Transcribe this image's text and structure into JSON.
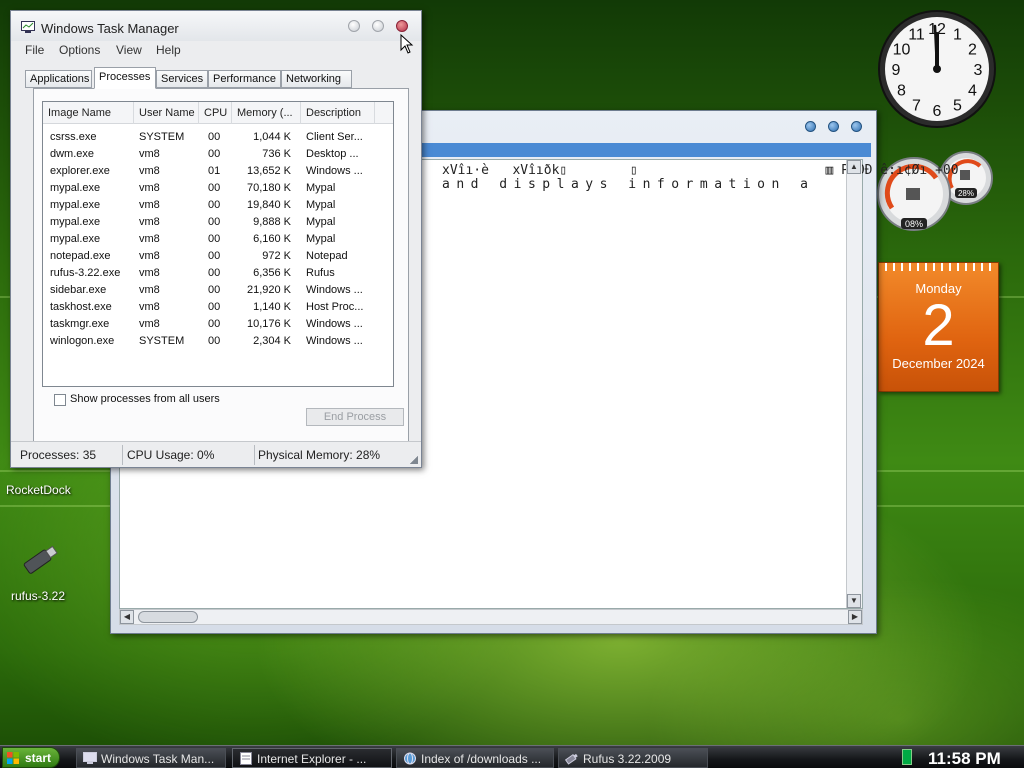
{
  "taskmanager": {
    "title": "Windows Task Manager",
    "menu": [
      "File",
      "Options",
      "View",
      "Help"
    ],
    "tabs": [
      "Applications",
      "Processes",
      "Services",
      "Performance",
      "Networking"
    ],
    "active_tab": "Processes",
    "columns": [
      "Image Name",
      "User Name",
      "CPU",
      "Memory (...",
      "Description"
    ],
    "processes": [
      [
        "csrss.exe",
        "SYSTEM",
        "00",
        "1,044 K",
        "Client Ser..."
      ],
      [
        "dwm.exe",
        "vm8",
        "00",
        "736 K",
        "Desktop ..."
      ],
      [
        "explorer.exe",
        "vm8",
        "01",
        "13,652 K",
        "Windows ..."
      ],
      [
        "mypal.exe",
        "vm8",
        "00",
        "70,180 K",
        "Mypal"
      ],
      [
        "mypal.exe",
        "vm8",
        "00",
        "19,840 K",
        "Mypal"
      ],
      [
        "mypal.exe",
        "vm8",
        "00",
        "9,888 K",
        "Mypal"
      ],
      [
        "mypal.exe",
        "vm8",
        "00",
        "6,160 K",
        "Mypal"
      ],
      [
        "notepad.exe",
        "vm8",
        "00",
        "972 K",
        "Notepad"
      ],
      [
        "rufus-3.22.exe",
        "vm8",
        "00",
        "6,356 K",
        "Rufus"
      ],
      [
        "sidebar.exe",
        "vm8",
        "00",
        "21,920 K",
        "Windows ..."
      ],
      [
        "taskhost.exe",
        "vm8",
        "00",
        "1,140 K",
        "Host Proc..."
      ],
      [
        "taskmgr.exe",
        "vm8",
        "00",
        "10,176 K",
        "Windows ..."
      ],
      [
        "winlogon.exe",
        "SYSTEM",
        "00",
        "2,304 K",
        "Windows ..."
      ]
    ],
    "show_all_label": "Show processes from all users",
    "end_process_label": "End Process",
    "status": {
      "processes": "Processes: 35",
      "cpu": "CPU Usage: 0%",
      "memory": "Physical Memory: 28%"
    }
  },
  "browser": {
    "line1": "xVîı·è   xVîıðk▯        ▯                        ▥ PàOÐ ê:ı¢Øı +00",
    "line2": "and displays information a"
  },
  "desktop": {
    "rocketdock_label": "RocketDock",
    "rufus_label": "rufus-3.22"
  },
  "gadgets": {
    "calendar": {
      "weekday": "Monday",
      "day": "2",
      "month_year": "December 2024"
    },
    "cpu_meter": {
      "cpu": "08%",
      "memory": "28%"
    },
    "clock": {
      "numbers": [
        "12",
        "1",
        "2",
        "3",
        "4",
        "5",
        "6",
        "7",
        "8",
        "9",
        "10",
        "11"
      ]
    }
  },
  "taskbar": {
    "start_label": "start",
    "buttons": [
      {
        "label": "Windows Task Man...",
        "icon": "taskmanager-icon"
      },
      {
        "label": "Internet Explorer - ...",
        "icon": "notepad-icon"
      },
      {
        "label": "Index of /downloads ...",
        "icon": "mypal-icon"
      },
      {
        "label": "Rufus 3.22.2009",
        "icon": "usb-icon"
      }
    ],
    "time": "11:58 PM"
  },
  "colors": {
    "accent": "#2f7a12",
    "calendar": "#e06410",
    "close": "#b3304a"
  }
}
